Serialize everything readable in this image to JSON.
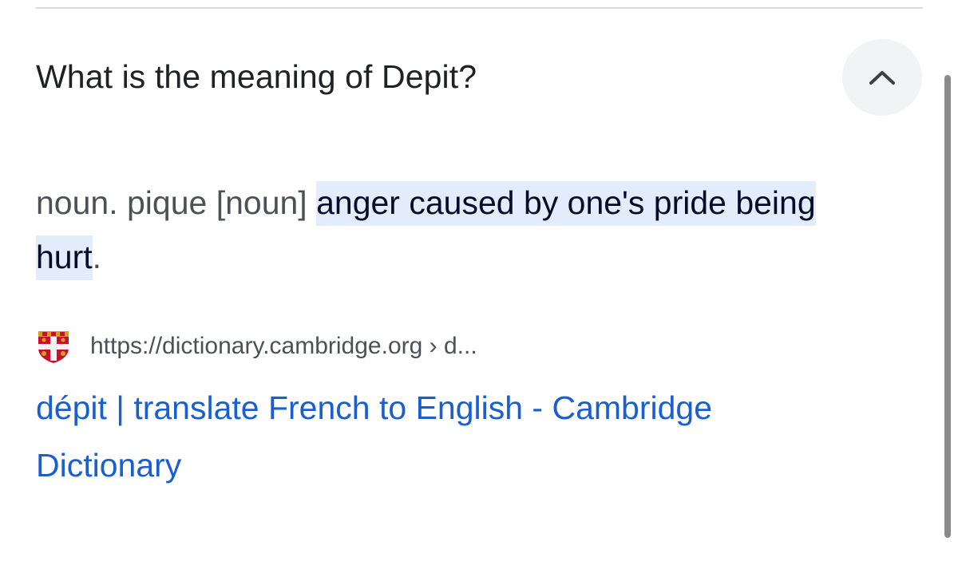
{
  "question": "What is the meaning of Depit?",
  "answer": {
    "prefix": "noun. pique [noun] ",
    "highlight_line1": "anger caused by one's pride being",
    "highlight_line2": "hurt",
    "suffix": "."
  },
  "source": {
    "favicon": "cambridge-crest-icon",
    "url": "https://dictionary.cambridge.org › d..."
  },
  "result": {
    "title": "dépit | translate French to English - Cambridge Dictionary"
  },
  "icons": {
    "collapse": "chevron-up-icon"
  },
  "colors": {
    "link": "#1a5fd0",
    "highlight": "#e3ecfb",
    "text": "#202124",
    "muted": "#4d5156"
  }
}
